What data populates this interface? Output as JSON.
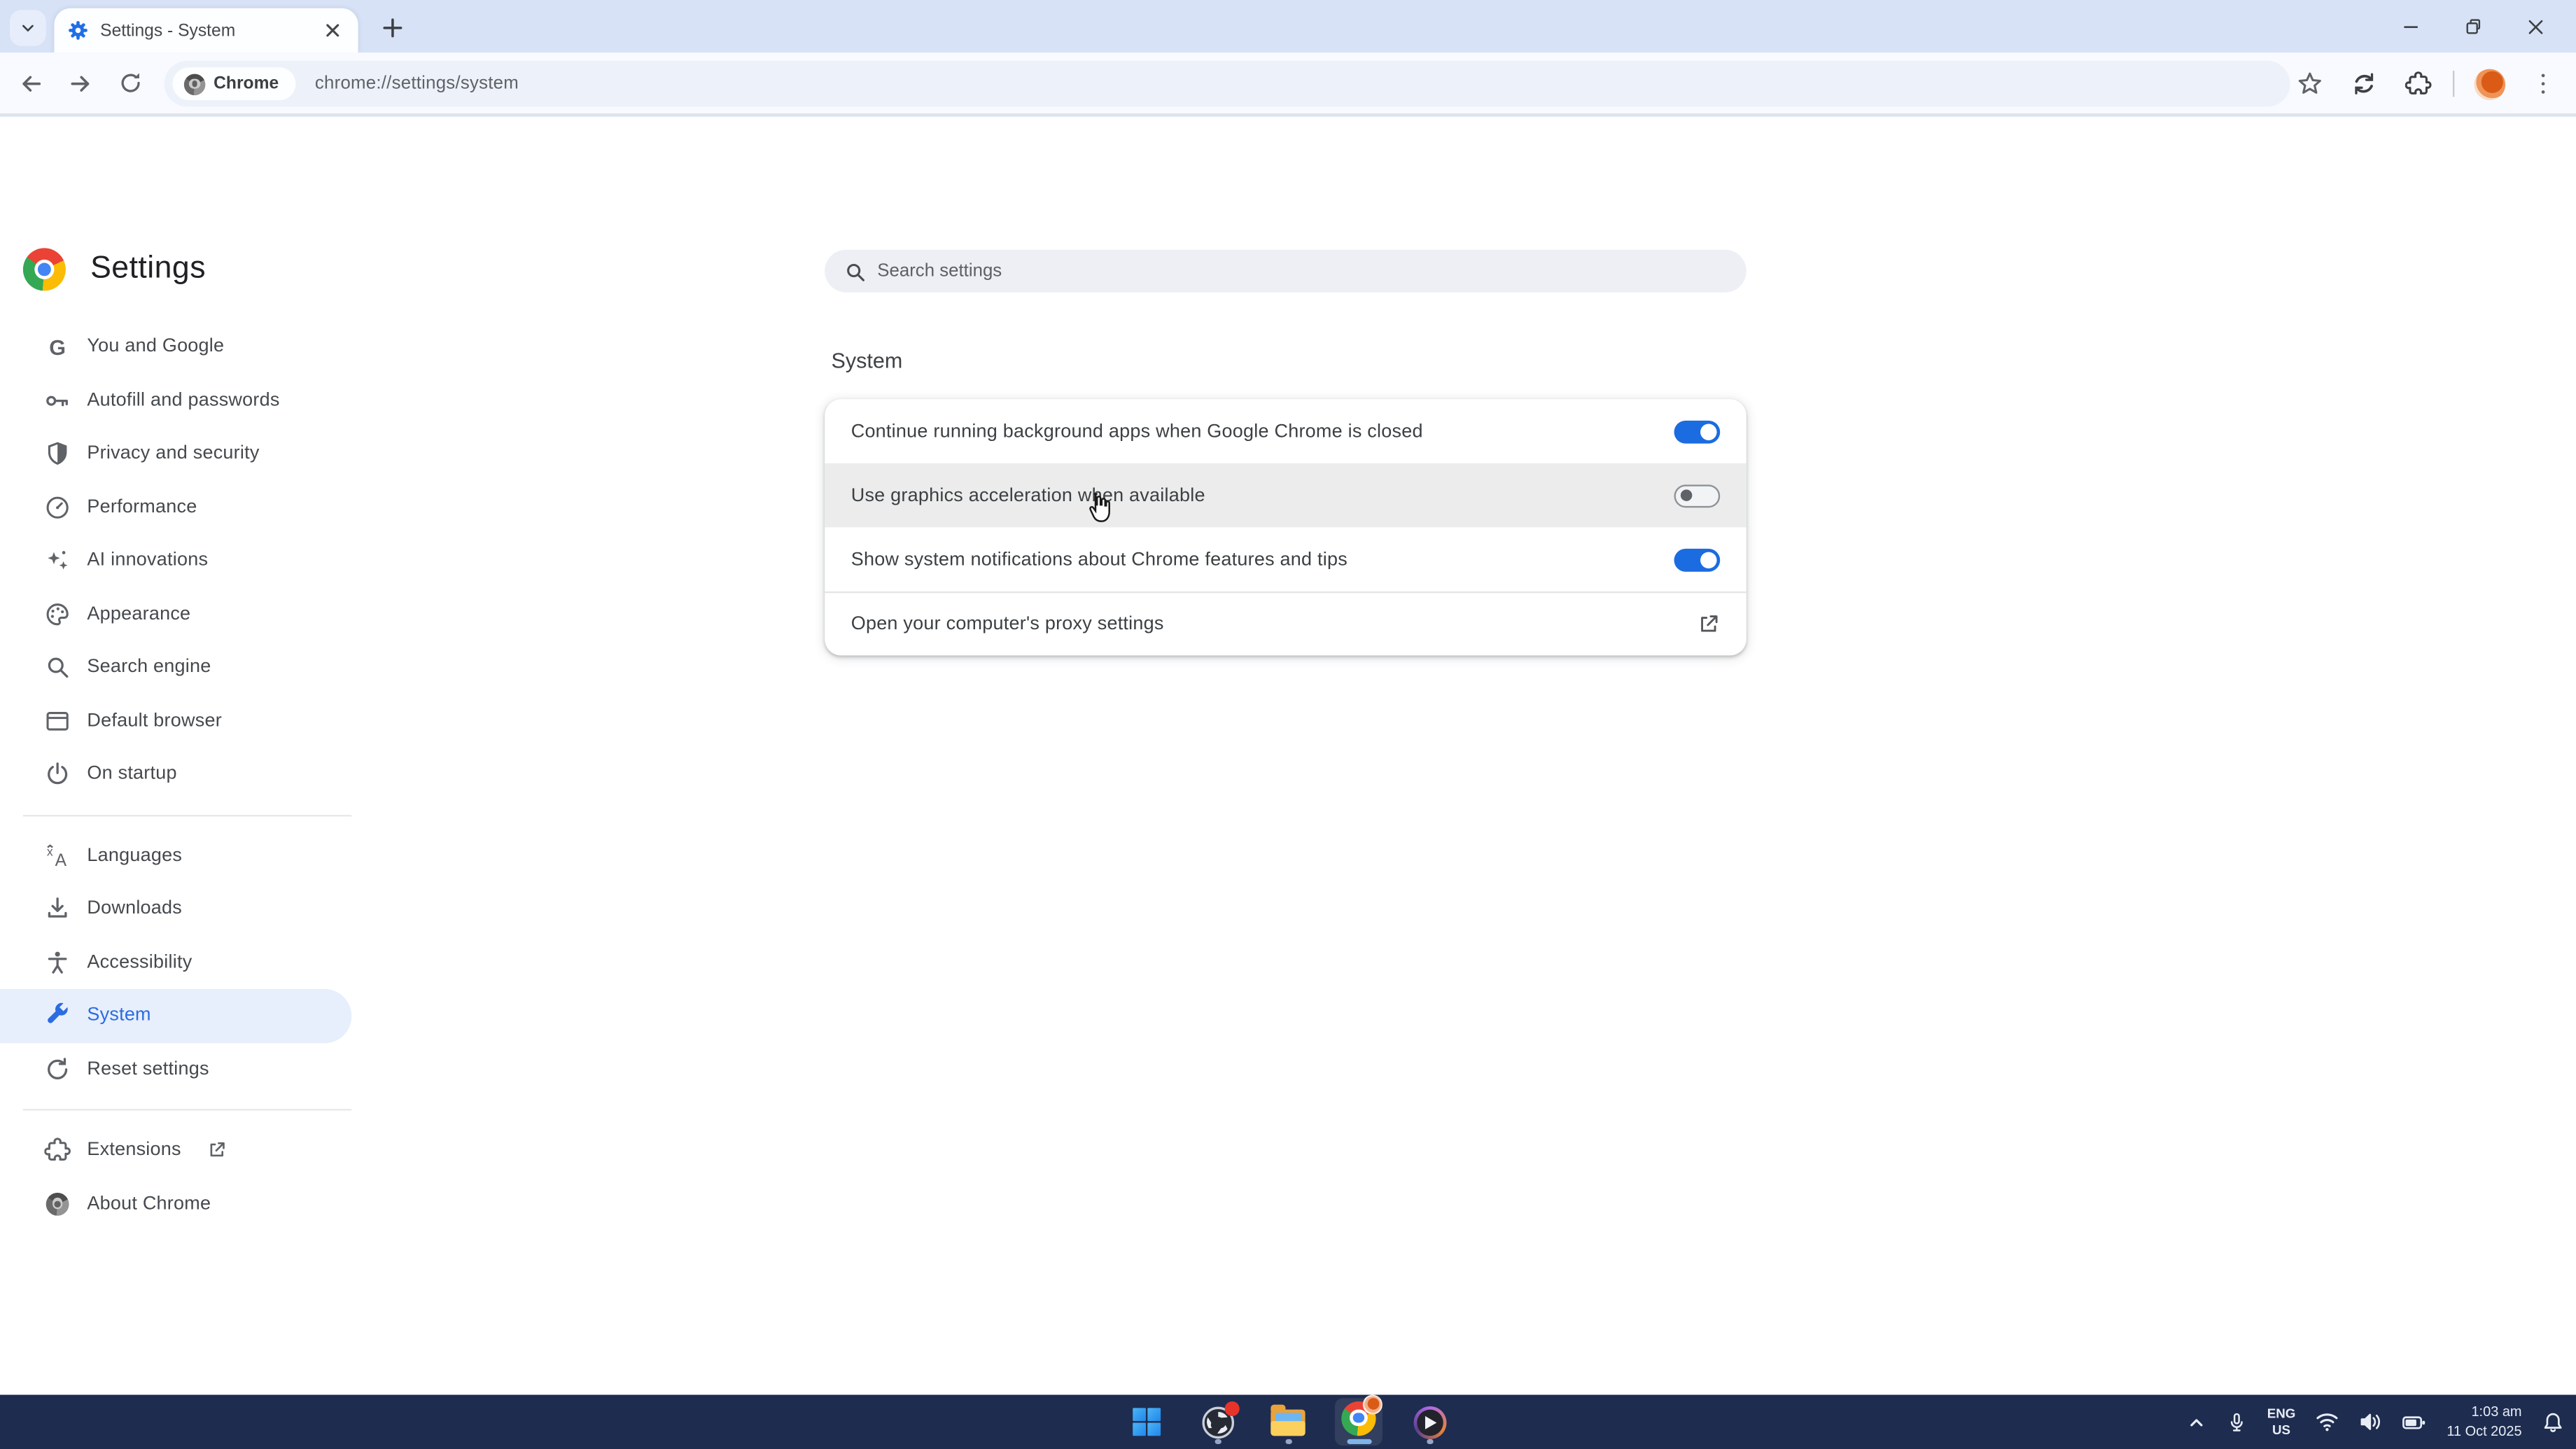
{
  "tabstrip": {
    "tab_title": "Settings - System"
  },
  "toolbar": {
    "site_chip_label": "Chrome",
    "url": "chrome://settings/system"
  },
  "sidebar": {
    "title": "Settings",
    "items": [
      {
        "label": "You and Google",
        "icon": "google-g"
      },
      {
        "label": "Autofill and passwords",
        "icon": "key"
      },
      {
        "label": "Privacy and security",
        "icon": "shield"
      },
      {
        "label": "Performance",
        "icon": "speedometer"
      },
      {
        "label": "AI innovations",
        "icon": "sparkle"
      },
      {
        "label": "Appearance",
        "icon": "palette"
      },
      {
        "label": "Search engine",
        "icon": "magnifier"
      },
      {
        "label": "Default browser",
        "icon": "browser-window"
      },
      {
        "label": "On startup",
        "icon": "power"
      },
      {
        "label": "Languages",
        "icon": "translate"
      },
      {
        "label": "Downloads",
        "icon": "download"
      },
      {
        "label": "Accessibility",
        "icon": "accessibility-person"
      },
      {
        "label": "System",
        "icon": "wrench",
        "state": "selected"
      },
      {
        "label": "Reset settings",
        "icon": "reset-arrow"
      },
      {
        "label": "Extensions",
        "icon": "puzzle",
        "external": true
      },
      {
        "label": "About Chrome",
        "icon": "chrome-logo"
      }
    ]
  },
  "main": {
    "search_placeholder": "Search settings",
    "section_title": "System",
    "rows": [
      {
        "label": "Continue running background apps when Google Chrome is closed",
        "control": "toggle",
        "state": "on",
        "row_class": ""
      },
      {
        "label": "Use graphics acceleration when available",
        "control": "toggle",
        "state": "off",
        "row_class": "hovered"
      },
      {
        "label": "Show system notifications about Chrome features and tips",
        "control": "toggle",
        "state": "on",
        "row_class": ""
      },
      {
        "label": "Open your computer's proxy settings",
        "control": "external-link",
        "state": "",
        "row_class": "divided"
      }
    ]
  },
  "taskbar": {
    "apps": [
      {
        "name": "start"
      },
      {
        "name": "obs",
        "running": true
      },
      {
        "name": "file-explorer",
        "running": true
      },
      {
        "name": "chrome",
        "running": true,
        "active": true
      },
      {
        "name": "media-player",
        "running": true
      }
    ],
    "tray": {
      "language_top": "ENG",
      "language_bottom": "US",
      "time": "1:03 am",
      "date": "11 Oct 2025"
    }
  },
  "colors": {
    "accent_blue": "#1b6ce0",
    "sidebar_selected_text": "#2b6ce0",
    "sidebar_selected_bg": "#e7eefc",
    "tabstrip_bg": "#d8e2f6",
    "taskbar_bg": "#1e2c4f"
  }
}
